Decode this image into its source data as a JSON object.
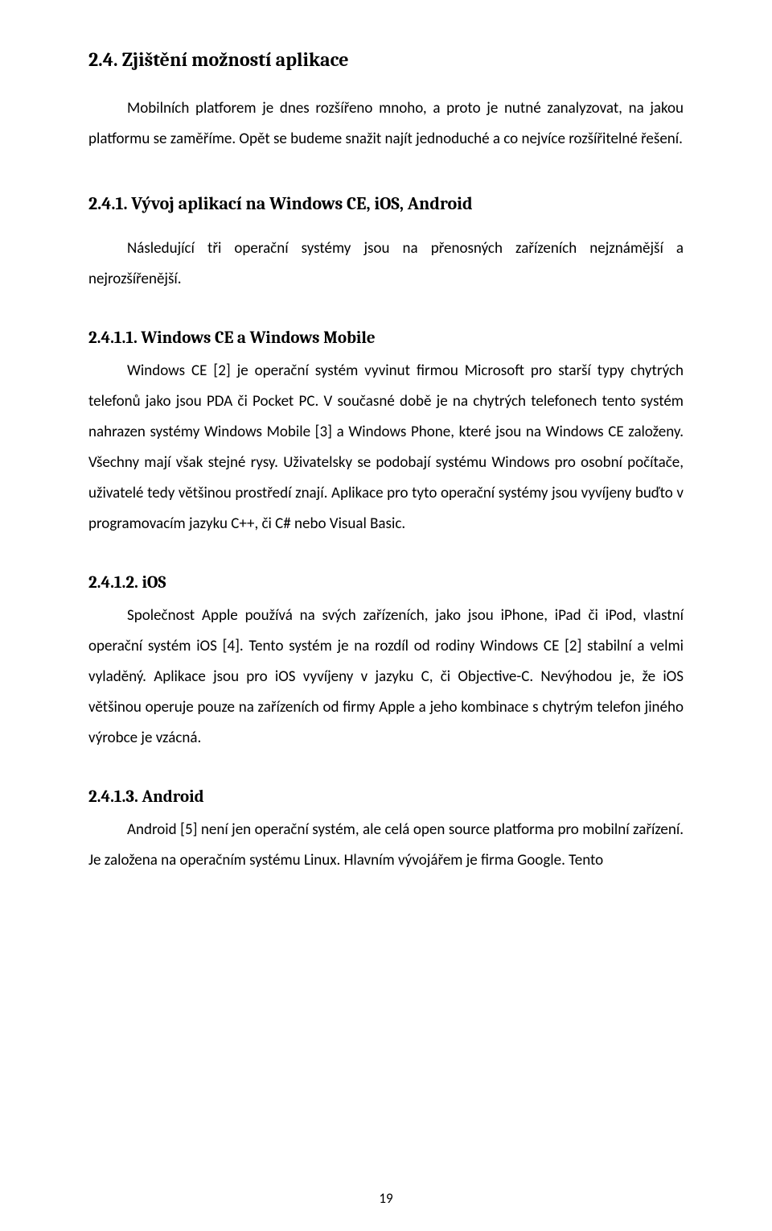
{
  "section_2_4": {
    "heading": "2.4. Zjištění možností aplikace",
    "para1": "Mobilních platforem je dnes rozšířeno mnoho, a proto je nutné zanalyzovat, na jakou platformu se zaměříme. Opět se budeme snažit najít jednoduché a co nejvíce rozšířitelné řešení."
  },
  "section_2_4_1": {
    "heading": "2.4.1. Vývoj aplikací na Windows CE, iOS, Android",
    "para1": "Následující tři operační systémy jsou na přenosných zařízeních nejznámější a nejrozšířenější."
  },
  "section_2_4_1_1": {
    "heading": "2.4.1.1. Windows CE a Windows Mobile",
    "para1": "Windows CE [2] je operační systém vyvinut firmou Microsoft pro starší typy chytrých telefonů jako jsou PDA či Pocket PC. V současné době je na chytrých telefonech tento systém nahrazen systémy Windows Mobile [3] a Windows Phone, které jsou na Windows CE založeny. Všechny mají však stejné rysy. Uživatelsky se podobají systému Windows pro osobní počítače, uživatelé tedy většinou prostředí znají. Aplikace pro tyto operační systémy jsou vyvíjeny buďto v programovacím jazyku C++, či C# nebo Visual Basic."
  },
  "section_2_4_1_2": {
    "heading": "2.4.1.2. iOS",
    "para1": "Společnost Apple používá na svých zařízeních, jako jsou iPhone, iPad či iPod, vlastní operační systém iOS [4]. Tento systém je na rozdíl od rodiny Windows CE [2] stabilní a velmi vyladěný. Aplikace jsou pro iOS vyvíjeny v jazyku C, či Objective-C. Nevýhodou je, že iOS většinou operuje pouze na zařízeních od firmy Apple a jeho kombinace s chytrým telefon jiného výrobce je vzácná."
  },
  "section_2_4_1_3": {
    "heading": "2.4.1.3. Android",
    "para1": "Android [5] není jen operační systém, ale celá open source platforma pro mobilní zařízení. Je založena na operačním systému Linux. Hlavním vývojářem je firma Google. Tento"
  },
  "page_number": "19"
}
